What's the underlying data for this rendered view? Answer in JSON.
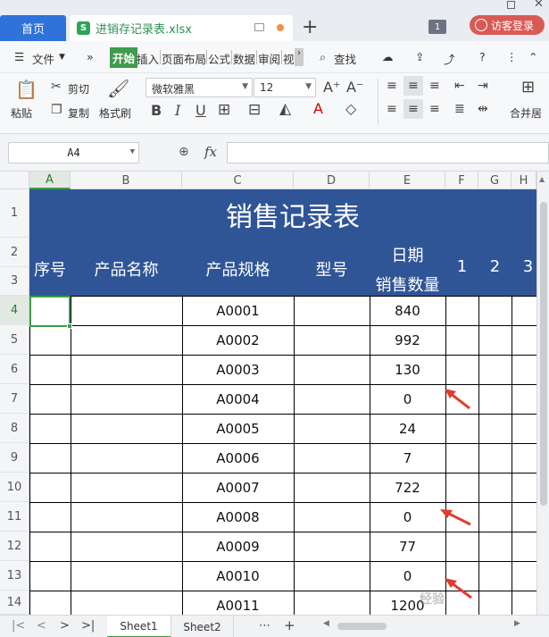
{
  "titlebar": {
    "home_tab": "首页",
    "file_tab": "进销存记录表.xlsx",
    "file_icon": "S",
    "badge": "1",
    "login": "访客登录",
    "colors": {
      "home_tab": "#2f72d9",
      "login": "#d95a55",
      "dot": "#f29046"
    }
  },
  "menubar": {
    "file": "文件",
    "more": "»",
    "tabs": [
      "开始",
      "插入",
      "页面布局",
      "公式",
      "数据",
      "审阅",
      "视"
    ],
    "search": "查找"
  },
  "ribbon": {
    "paste": "粘贴",
    "cut": "剪切",
    "copy": "复制",
    "format_painter": "格式刷",
    "font_name": "微软雅黑",
    "font_size": "12",
    "merge": "合并居"
  },
  "formula_bar": {
    "name_box": "A4",
    "fx": "fx",
    "formula": ""
  },
  "columns": [
    "A",
    "B",
    "C",
    "D",
    "E",
    "F",
    "G",
    "H"
  ],
  "rows": [
    "1",
    "2",
    "3",
    "4",
    "5",
    "6",
    "7",
    "8",
    "9",
    "10",
    "11",
    "12",
    "13",
    "14"
  ],
  "sheet": {
    "title": "销售记录表",
    "headers": {
      "seq": "序号",
      "product_name": "产品名称",
      "spec": "产品规格",
      "model": "型号",
      "date": "日期",
      "sales_qty": "销售数量",
      "d1": "1",
      "d2": "2",
      "d3": "3"
    },
    "header_color": "#2f5597",
    "records": [
      {
        "spec": "A0001",
        "qty": "840"
      },
      {
        "spec": "A0002",
        "qty": "992"
      },
      {
        "spec": "A0003",
        "qty": "130"
      },
      {
        "spec": "A0004",
        "qty": "0"
      },
      {
        "spec": "A0005",
        "qty": "24"
      },
      {
        "spec": "A0006",
        "qty": "7"
      },
      {
        "spec": "A0007",
        "qty": "722"
      },
      {
        "spec": "A0008",
        "qty": "0"
      },
      {
        "spec": "A0009",
        "qty": "77"
      },
      {
        "spec": "A0010",
        "qty": "0"
      },
      {
        "spec": "A0011",
        "qty": "1200"
      }
    ]
  },
  "sheet_tabs": [
    "Sheet1",
    "Sheet2"
  ],
  "watermark": "经验"
}
